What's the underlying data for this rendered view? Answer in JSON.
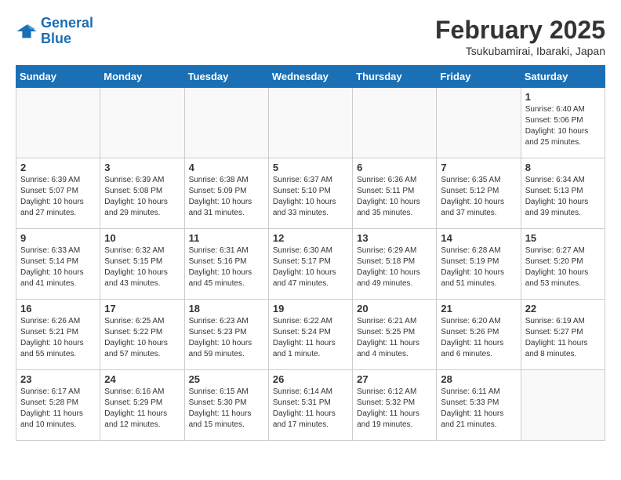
{
  "header": {
    "logo_line1": "General",
    "logo_line2": "Blue",
    "month_year": "February 2025",
    "location": "Tsukubamirai, Ibaraki, Japan"
  },
  "weekdays": [
    "Sunday",
    "Monday",
    "Tuesday",
    "Wednesday",
    "Thursday",
    "Friday",
    "Saturday"
  ],
  "weeks": [
    [
      {
        "day": "",
        "info": ""
      },
      {
        "day": "",
        "info": ""
      },
      {
        "day": "",
        "info": ""
      },
      {
        "day": "",
        "info": ""
      },
      {
        "day": "",
        "info": ""
      },
      {
        "day": "",
        "info": ""
      },
      {
        "day": "1",
        "info": "Sunrise: 6:40 AM\nSunset: 5:06 PM\nDaylight: 10 hours\nand 25 minutes."
      }
    ],
    [
      {
        "day": "2",
        "info": "Sunrise: 6:39 AM\nSunset: 5:07 PM\nDaylight: 10 hours\nand 27 minutes."
      },
      {
        "day": "3",
        "info": "Sunrise: 6:39 AM\nSunset: 5:08 PM\nDaylight: 10 hours\nand 29 minutes."
      },
      {
        "day": "4",
        "info": "Sunrise: 6:38 AM\nSunset: 5:09 PM\nDaylight: 10 hours\nand 31 minutes."
      },
      {
        "day": "5",
        "info": "Sunrise: 6:37 AM\nSunset: 5:10 PM\nDaylight: 10 hours\nand 33 minutes."
      },
      {
        "day": "6",
        "info": "Sunrise: 6:36 AM\nSunset: 5:11 PM\nDaylight: 10 hours\nand 35 minutes."
      },
      {
        "day": "7",
        "info": "Sunrise: 6:35 AM\nSunset: 5:12 PM\nDaylight: 10 hours\nand 37 minutes."
      },
      {
        "day": "8",
        "info": "Sunrise: 6:34 AM\nSunset: 5:13 PM\nDaylight: 10 hours\nand 39 minutes."
      }
    ],
    [
      {
        "day": "9",
        "info": "Sunrise: 6:33 AM\nSunset: 5:14 PM\nDaylight: 10 hours\nand 41 minutes."
      },
      {
        "day": "10",
        "info": "Sunrise: 6:32 AM\nSunset: 5:15 PM\nDaylight: 10 hours\nand 43 minutes."
      },
      {
        "day": "11",
        "info": "Sunrise: 6:31 AM\nSunset: 5:16 PM\nDaylight: 10 hours\nand 45 minutes."
      },
      {
        "day": "12",
        "info": "Sunrise: 6:30 AM\nSunset: 5:17 PM\nDaylight: 10 hours\nand 47 minutes."
      },
      {
        "day": "13",
        "info": "Sunrise: 6:29 AM\nSunset: 5:18 PM\nDaylight: 10 hours\nand 49 minutes."
      },
      {
        "day": "14",
        "info": "Sunrise: 6:28 AM\nSunset: 5:19 PM\nDaylight: 10 hours\nand 51 minutes."
      },
      {
        "day": "15",
        "info": "Sunrise: 6:27 AM\nSunset: 5:20 PM\nDaylight: 10 hours\nand 53 minutes."
      }
    ],
    [
      {
        "day": "16",
        "info": "Sunrise: 6:26 AM\nSunset: 5:21 PM\nDaylight: 10 hours\nand 55 minutes."
      },
      {
        "day": "17",
        "info": "Sunrise: 6:25 AM\nSunset: 5:22 PM\nDaylight: 10 hours\nand 57 minutes."
      },
      {
        "day": "18",
        "info": "Sunrise: 6:23 AM\nSunset: 5:23 PM\nDaylight: 10 hours\nand 59 minutes."
      },
      {
        "day": "19",
        "info": "Sunrise: 6:22 AM\nSunset: 5:24 PM\nDaylight: 11 hours\nand 1 minute."
      },
      {
        "day": "20",
        "info": "Sunrise: 6:21 AM\nSunset: 5:25 PM\nDaylight: 11 hours\nand 4 minutes."
      },
      {
        "day": "21",
        "info": "Sunrise: 6:20 AM\nSunset: 5:26 PM\nDaylight: 11 hours\nand 6 minutes."
      },
      {
        "day": "22",
        "info": "Sunrise: 6:19 AM\nSunset: 5:27 PM\nDaylight: 11 hours\nand 8 minutes."
      }
    ],
    [
      {
        "day": "23",
        "info": "Sunrise: 6:17 AM\nSunset: 5:28 PM\nDaylight: 11 hours\nand 10 minutes."
      },
      {
        "day": "24",
        "info": "Sunrise: 6:16 AM\nSunset: 5:29 PM\nDaylight: 11 hours\nand 12 minutes."
      },
      {
        "day": "25",
        "info": "Sunrise: 6:15 AM\nSunset: 5:30 PM\nDaylight: 11 hours\nand 15 minutes."
      },
      {
        "day": "26",
        "info": "Sunrise: 6:14 AM\nSunset: 5:31 PM\nDaylight: 11 hours\nand 17 minutes."
      },
      {
        "day": "27",
        "info": "Sunrise: 6:12 AM\nSunset: 5:32 PM\nDaylight: 11 hours\nand 19 minutes."
      },
      {
        "day": "28",
        "info": "Sunrise: 6:11 AM\nSunset: 5:33 PM\nDaylight: 11 hours\nand 21 minutes."
      },
      {
        "day": "",
        "info": ""
      }
    ]
  ]
}
